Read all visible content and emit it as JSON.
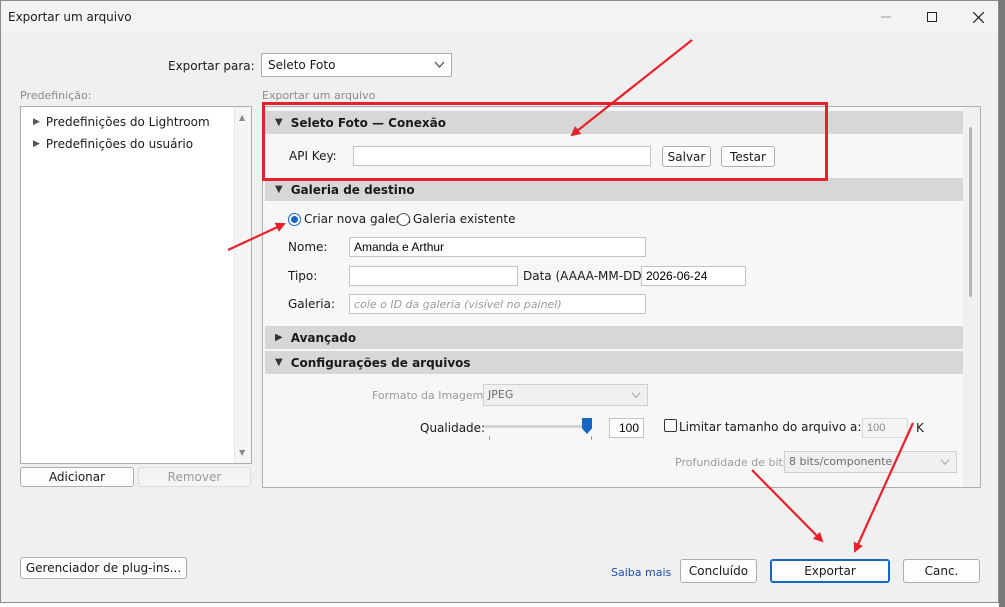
{
  "window": {
    "title": "Exportar um arquivo"
  },
  "top": {
    "export_to_label": "Exportar para:",
    "export_to_value": "Seleto Foto"
  },
  "presets": {
    "label": "Predefinição:",
    "items": [
      {
        "label": "Predefinições do Lightroom"
      },
      {
        "label": "Predefinições do usuário"
      }
    ],
    "add_button": "Adicionar",
    "remove_button": "Remover"
  },
  "panel": {
    "label": "Exportar um arquivo",
    "connection": {
      "title": "Seleto Foto — Conexão",
      "api_key_label": "API Key:",
      "api_key_value": "",
      "save_button": "Salvar",
      "test_button": "Testar"
    },
    "gallery": {
      "title": "Galeria de destino",
      "radio_new": "Criar nova galeria",
      "radio_existing": "Galeria existente",
      "name_label": "Nome:",
      "name_value": "Amanda e Arthur",
      "type_label": "Tipo:",
      "type_value": "",
      "date_label": "Data (AAAA-MM-DD):",
      "date_value": "2026-06-24",
      "gallery_label": "Galeria:",
      "gallery_placeholder": "cole o ID da galeria (visível no painel)"
    },
    "advanced": {
      "title": "Avançado"
    },
    "file_settings": {
      "title": "Configurações de arquivos",
      "format_label": "Formato da Imagem:",
      "format_value": "JPEG",
      "quality_label": "Qualidade:",
      "quality_value": "100",
      "quality_level": 100,
      "limit_label": "Limitar tamanho do arquivo a:",
      "limit_value": "100",
      "limit_unit": "K",
      "depth_label": "Profundidade de bits:",
      "depth_value": "8 bits/componente"
    }
  },
  "bottom": {
    "plugin_manager_button": "Gerenciador de plug-ins...",
    "learn_more_link": "Saiba mais",
    "done_button": "Concluído",
    "export_button": "Exportar",
    "cancel_button": "Canc."
  },
  "colors": {
    "accent": "#1666c5",
    "annotation": "#e8202a"
  }
}
